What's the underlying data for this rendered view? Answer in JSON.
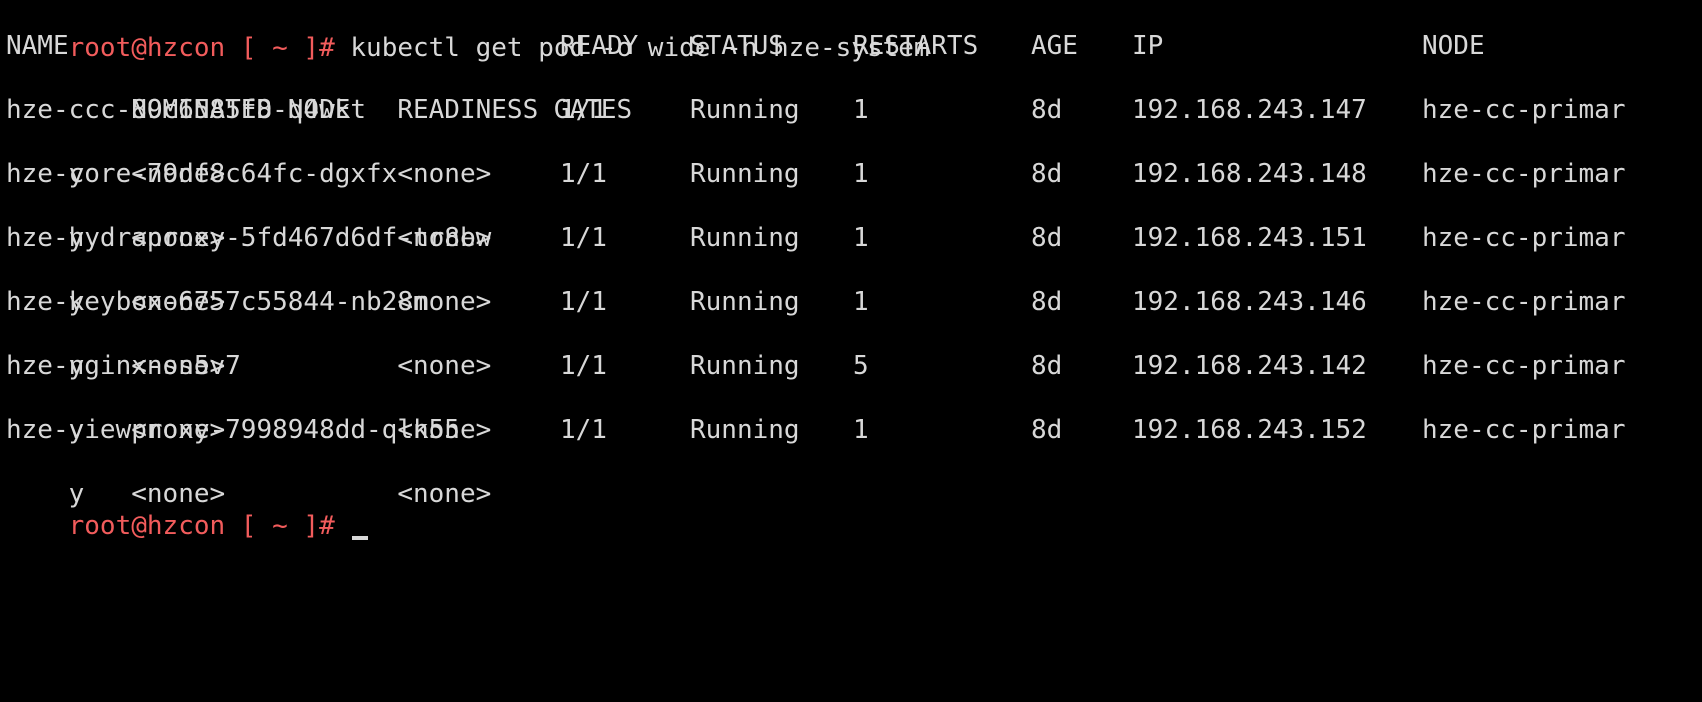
{
  "terminal": {
    "prompt": "root@hzcon [ ~ ]# ",
    "command": "kubectl get pod -o wide -n hze-system",
    "header": {
      "name": "NAME",
      "ready": "READY",
      "status": "STATUS",
      "restarts": "RESTARTS",
      "age": "AGE",
      "ip": "IP",
      "node": "NODE",
      "wrap": "    NOMINATED NODE   READINESS GATES"
    },
    "pods": [
      {
        "name": "hze-ccc-89c6585f8-q4wkt",
        "ready": "1/1",
        "status": "Running",
        "restarts": "1",
        "age": "8d",
        "ip": "192.168.243.147",
        "node": "hze-cc-primar",
        "wrap": "y   <none>           <none>"
      },
      {
        "name": "hze-core-79df8c64fc-dgxfx",
        "ready": "1/1",
        "status": "Running",
        "restarts": "1",
        "age": "8d",
        "ip": "192.168.243.148",
        "node": "hze-cc-primar",
        "wrap": "y   <none>           <none>"
      },
      {
        "name": "hze-hydraproxy-5fd467d6df-tr8bw",
        "ready": "1/1",
        "status": "Running",
        "restarts": "1",
        "age": "8d",
        "ip": "192.168.243.151",
        "node": "hze-cc-primar",
        "wrap": "y   <none>           <none>"
      },
      {
        "name": "hze-keybox-6757c55844-nb28m",
        "ready": "1/1",
        "status": "Running",
        "restarts": "1",
        "age": "8d",
        "ip": "192.168.243.146",
        "node": "hze-cc-primar",
        "wrap": "y   <none>           <none>"
      },
      {
        "name": "hze-nginx-ss5v7",
        "ready": "1/1",
        "status": "Running",
        "restarts": "5",
        "age": "8d",
        "ip": "192.168.243.142",
        "node": "hze-cc-primar",
        "wrap": "y   <none>           <none>"
      },
      {
        "name": "hze-viewproxy-7998948dd-qlk55",
        "ready": "1/1",
        "status": "Running",
        "restarts": "1",
        "age": "8d",
        "ip": "192.168.243.152",
        "node": "hze-cc-primar",
        "wrap": "y   <none>           <none>"
      }
    ],
    "colors": {
      "background": "#000000",
      "text": "#d8d8d8",
      "prompt": "#f25c5c"
    }
  }
}
